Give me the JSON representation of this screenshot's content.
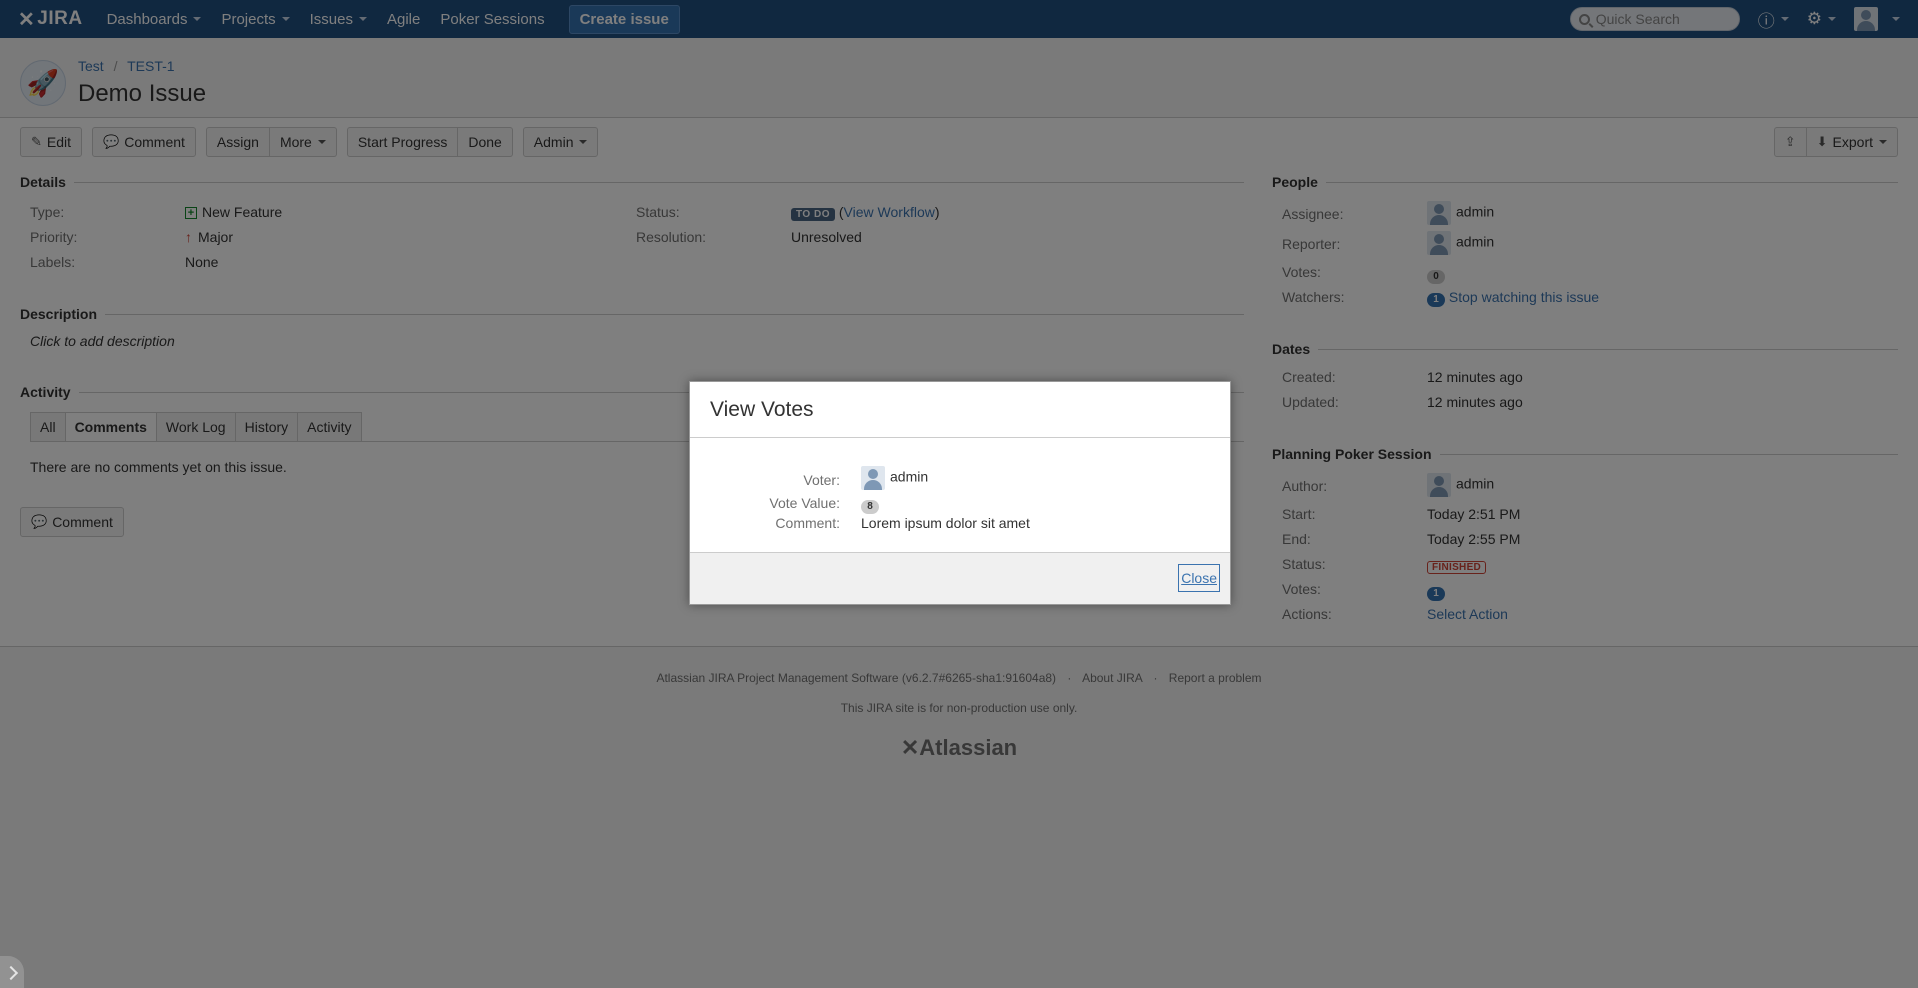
{
  "topnav": {
    "logo": "JIRA",
    "items": [
      {
        "label": "Dashboards",
        "dropdown": true
      },
      {
        "label": "Projects",
        "dropdown": true
      },
      {
        "label": "Issues",
        "dropdown": true
      },
      {
        "label": "Agile",
        "dropdown": false
      },
      {
        "label": "Poker Sessions",
        "dropdown": false
      }
    ],
    "create_label": "Create issue",
    "search_placeholder": "Quick Search",
    "help_icon": "help-icon",
    "settings_icon": "gear-icon"
  },
  "header": {
    "project": "Test",
    "separator": "/",
    "issue_key": "TEST-1",
    "title": "Demo Issue"
  },
  "toolbar": {
    "edit": "Edit",
    "comment": "Comment",
    "assign": "Assign",
    "more": "More",
    "start_progress": "Start Progress",
    "done": "Done",
    "admin": "Admin",
    "export": "Export"
  },
  "details": {
    "title": "Details",
    "type_label": "Type:",
    "type_value": "New Feature",
    "priority_label": "Priority:",
    "priority_value": "Major",
    "labels_label": "Labels:",
    "labels_value": "None",
    "status_label": "Status:",
    "status_value": "TO DO",
    "status_open_paren": "(",
    "view_workflow": "View Workflow",
    "status_close_paren": ")",
    "resolution_label": "Resolution:",
    "resolution_value": "Unresolved"
  },
  "description": {
    "title": "Description",
    "placeholder": "Click to add description"
  },
  "activity": {
    "title": "Activity",
    "tabs": [
      "All",
      "Comments",
      "Work Log",
      "History",
      "Activity"
    ],
    "active_tab": "Comments",
    "empty_message": "There are no comments yet on this issue.",
    "comment_button": "Comment"
  },
  "people": {
    "title": "People",
    "assignee_label": "Assignee:",
    "assignee": "admin",
    "reporter_label": "Reporter:",
    "reporter": "admin",
    "votes_label": "Votes:",
    "votes": "0",
    "watchers_label": "Watchers:",
    "watchers": "1",
    "watch_link": "Stop watching this issue"
  },
  "dates": {
    "title": "Dates",
    "created_label": "Created:",
    "created": "12 minutes ago",
    "updated_label": "Updated:",
    "updated": "12 minutes ago"
  },
  "poker": {
    "title": "Planning Poker Session",
    "author_label": "Author:",
    "author": "admin",
    "start_label": "Start:",
    "start": "Today 2:51 PM",
    "end_label": "End:",
    "end": "Today 2:55 PM",
    "status_label": "Status:",
    "status": "FINISHED",
    "votes_label": "Votes:",
    "votes": "1",
    "actions_label": "Actions:",
    "actions": "Select Action"
  },
  "footer": {
    "software": "Atlassian JIRA Project Management Software (v6.2.7#6265-sha1:91604a8)",
    "dot": "·",
    "about": "About JIRA",
    "report": "Report a problem",
    "notice": "This JIRA site is for non-production use only.",
    "brand": "Atlassian"
  },
  "dialog": {
    "title": "View Votes",
    "voter_label": "Voter:",
    "voter": "admin",
    "vote_value_label": "Vote Value:",
    "vote_value": "8",
    "comment_label": "Comment:",
    "comment": "Lorem ipsum dolor sit amet",
    "close": "Close"
  }
}
